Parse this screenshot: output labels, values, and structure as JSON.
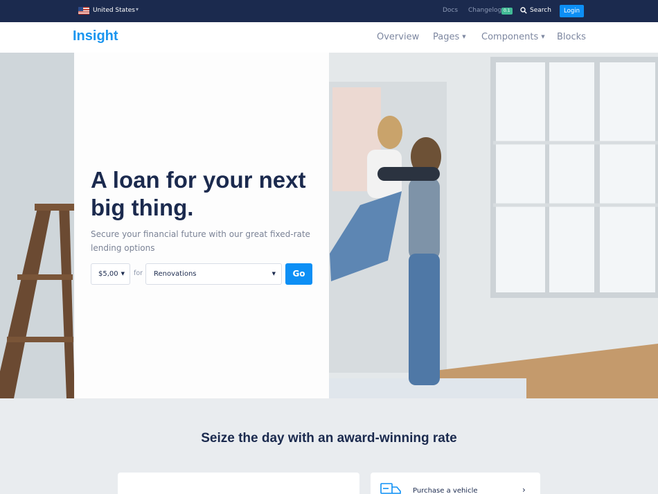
{
  "topbar": {
    "country": "United States",
    "docs": "Docs",
    "changelog": "Changelog",
    "changelog_badge": "0.1",
    "search": "Search",
    "login": "Login"
  },
  "navbar": {
    "brand": "Insight",
    "items": [
      "Overview",
      "Pages",
      "Components",
      "Blocks"
    ]
  },
  "hero": {
    "title": "A loan for your next big thing.",
    "subtitle": "Secure your financial future with our great fixed-rate lending options",
    "amount": "$5,00",
    "for_label": "for",
    "purpose": "Renovations",
    "go_label": "Go"
  },
  "section": {
    "title": "Seize the day with an award-winning rate",
    "card_label": "Purchase a vehicle"
  },
  "colors": {
    "navy": "#1b2a4e",
    "primary": "#0d8ff5",
    "brand": "#1a95ef",
    "badge": "#42ba96"
  }
}
